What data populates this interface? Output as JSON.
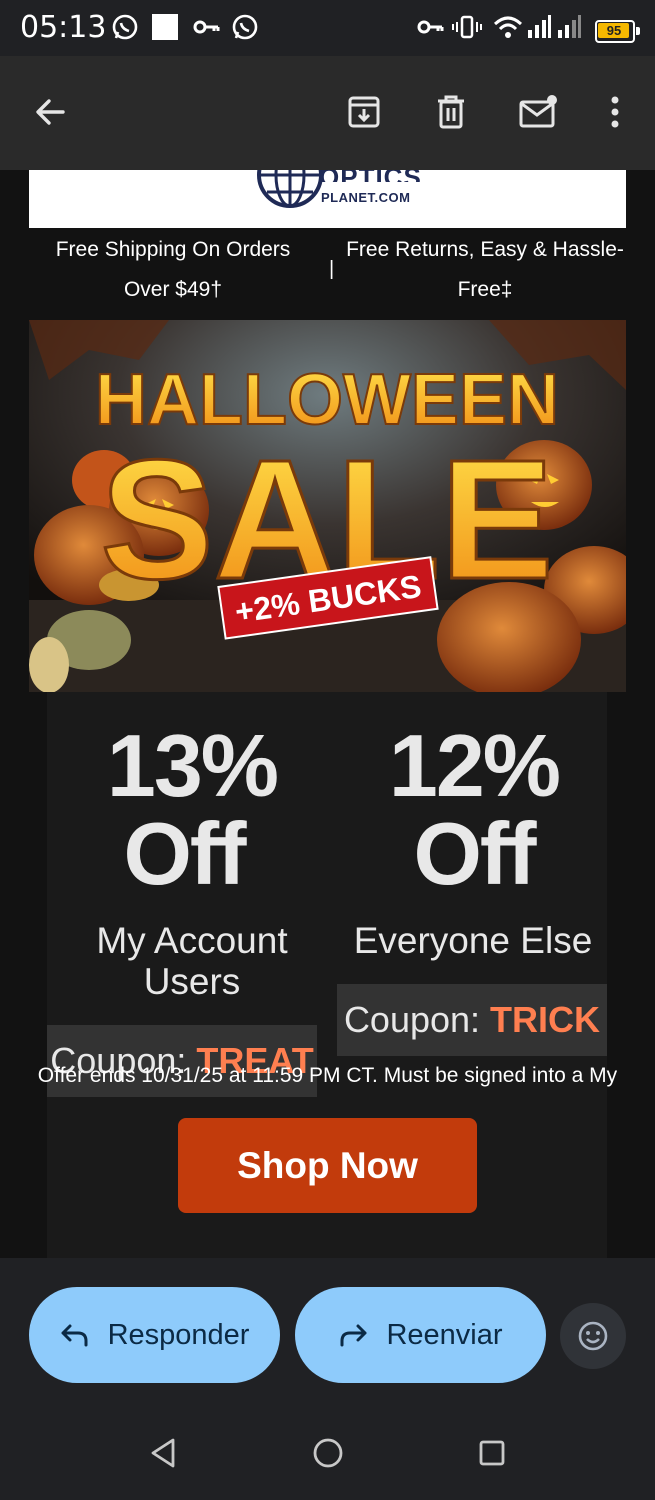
{
  "status_bar": {
    "time": "05:13",
    "battery": "95",
    "icons": [
      "whatsapp-icon",
      "square-icon",
      "key-icon",
      "whatsapp-icon",
      "vpn-key-icon",
      "vibrate-icon",
      "wifi-icon",
      "signal-icon",
      "signal-icon",
      "battery-icon"
    ]
  },
  "toolbar": {
    "icons": [
      "back-arrow-icon",
      "archive-icon",
      "trash-icon",
      "mark-unread-icon",
      "more-vert-icon"
    ]
  },
  "email": {
    "logo_text": "PLANET.COM",
    "shipping_left": "Free Shipping On Orders Over $49†",
    "shipping_sep": "|",
    "shipping_right": "Free Returns, Easy & Hassle-Free‡",
    "banner": {
      "line1": "HALLOWEEN",
      "line2": "SALE",
      "badge": "+2% BUCKS"
    },
    "offers": [
      {
        "percent": "13%",
        "off": "Off",
        "audience": "My Account Users",
        "coupon_label": "Coupon: ",
        "coupon_code": "TREAT"
      },
      {
        "percent": "12%",
        "off": "Off",
        "audience": "Everyone Else",
        "coupon_label": "Coupon: ",
        "coupon_code": "TRICK"
      }
    ],
    "cta": "Shop Now",
    "offer_ends": "Offer ends 10/31/25 at 11:59 PM CT. Must be signed into a My"
  },
  "actions": {
    "reply_label": "Responder",
    "forward_label": "Reenviar",
    "emoji_icon": "emoji-reaction-icon"
  },
  "nav": {
    "icons": [
      "back-triangle-icon",
      "home-circle-icon",
      "recents-square-icon"
    ]
  },
  "colors": {
    "accent": "#c23b0c",
    "coupon_code": "#ff7f50",
    "pill": "#8ecbfb",
    "battery": "#f5b800"
  }
}
